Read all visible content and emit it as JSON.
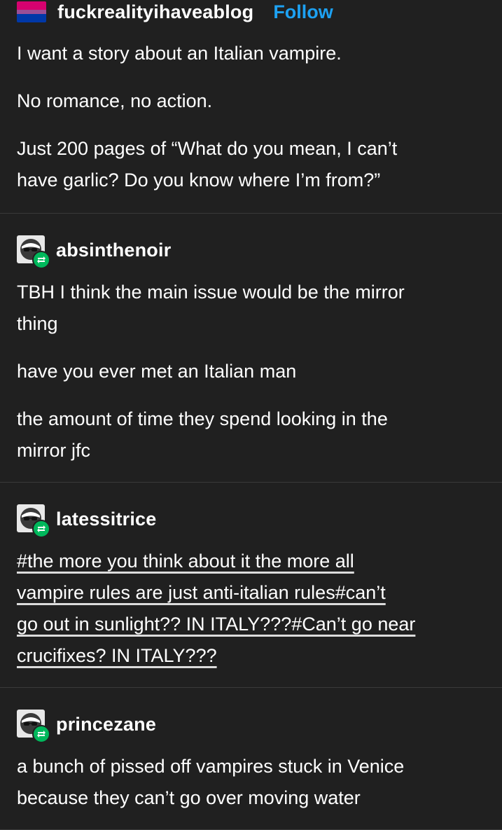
{
  "posts": [
    {
      "username": "fuckrealityihaveablog",
      "follow_label": "Follow",
      "avatar_icon": "pride-flag-icon",
      "flag_colors": [
        "#d6026f",
        "#d6026f",
        "#9b4f96",
        "#0038a8",
        "#0038a8"
      ],
      "paragraphs": [
        [
          "I want a story about an Italian vampire."
        ],
        [
          "No romance, no action."
        ],
        [
          "Just 200 pages of “What do you mean, I can’t",
          "have garlic? Do you know where I’m from?”"
        ]
      ]
    },
    {
      "username": "absinthenoir",
      "avatar_icon": "sunglasses-avatar-icon",
      "badge_icon": "reblog-icon",
      "paragraphs": [
        [
          "TBH I think the main issue would be the mirror",
          "thing"
        ],
        [
          "have you ever met an Italian man"
        ],
        [
          "the amount of time they spend looking in the",
          "mirror jfc"
        ]
      ]
    },
    {
      "username": "latessitrice",
      "avatar_icon": "sunglasses-avatar-icon",
      "badge_icon": "reblog-icon",
      "tag_lines": [
        "#the more you think about it the more all",
        "vampire rules are just anti-italian rules#can’t",
        "go out in sunlight?? IN ITALY???#Can’t go near",
        "crucifixes? IN ITALY???"
      ]
    },
    {
      "username": "princezane",
      "avatar_icon": "sunglasses-avatar-icon",
      "badge_icon": "reblog-icon",
      "paragraphs": [
        [
          "a bunch of pissed off vampires stuck in Venice",
          "because they can’t go over moving water"
        ]
      ]
    }
  ],
  "colors": {
    "background": "#202020",
    "text": "#ffffff",
    "follow": "#1da1f2",
    "reblog_badge": "#00b85c",
    "divider": "#3a3a3a"
  }
}
